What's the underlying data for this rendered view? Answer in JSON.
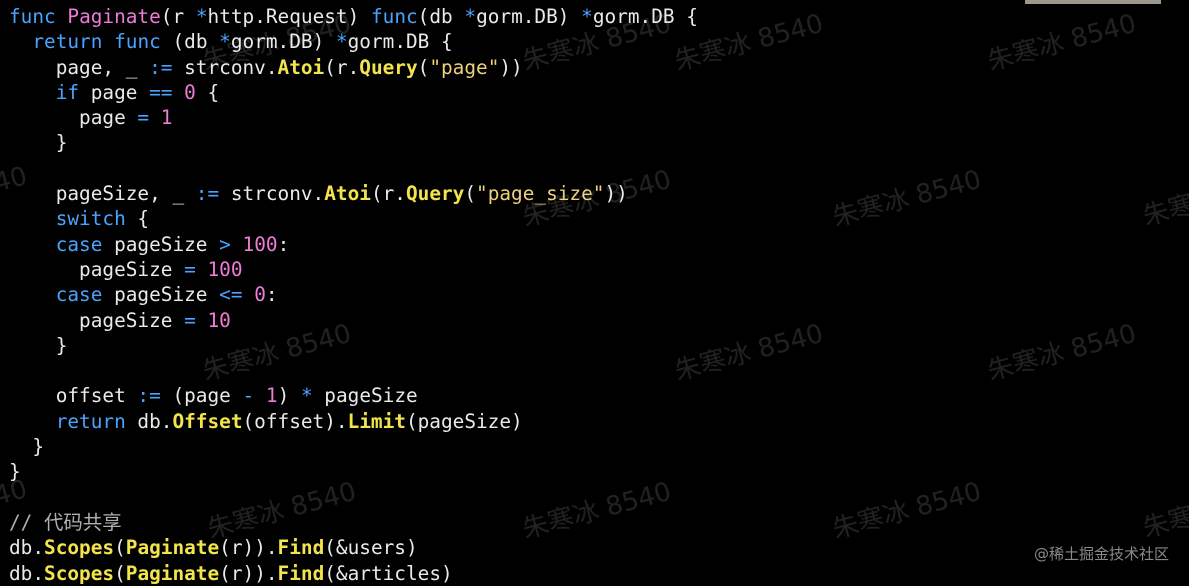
{
  "editor": {
    "lines": [
      [
        [
          "kw",
          "func"
        ],
        [
          "txt",
          " "
        ],
        [
          "fn",
          "Paginate"
        ],
        [
          "txt",
          "(r "
        ],
        [
          "op",
          "*"
        ],
        [
          "txt",
          "http.Request) "
        ],
        [
          "kw",
          "func"
        ],
        [
          "txt",
          "(db "
        ],
        [
          "op",
          "*"
        ],
        [
          "txt",
          "gorm.DB) "
        ],
        [
          "op",
          "*"
        ],
        [
          "txt",
          "gorm.DB {"
        ]
      ],
      [
        [
          "txt",
          "  "
        ],
        [
          "kw",
          "return"
        ],
        [
          "txt",
          " "
        ],
        [
          "kw",
          "func"
        ],
        [
          "txt",
          " (db "
        ],
        [
          "op",
          "*"
        ],
        [
          "txt",
          "gorm.DB) "
        ],
        [
          "op",
          "*"
        ],
        [
          "txt",
          "gorm.DB {"
        ]
      ],
      [
        [
          "txt",
          "    page, _ "
        ],
        [
          "op",
          ":="
        ],
        [
          "txt",
          " strconv."
        ],
        [
          "call",
          "Atoi"
        ],
        [
          "txt",
          "(r."
        ],
        [
          "call",
          "Query"
        ],
        [
          "txt",
          "("
        ],
        [
          "str",
          "\"page\""
        ],
        [
          "txt",
          "))"
        ]
      ],
      [
        [
          "txt",
          "    "
        ],
        [
          "kw",
          "if"
        ],
        [
          "txt",
          " page "
        ],
        [
          "op",
          "=="
        ],
        [
          "txt",
          " "
        ],
        [
          "num",
          "0"
        ],
        [
          "txt",
          " {"
        ]
      ],
      [
        [
          "txt",
          "      page "
        ],
        [
          "op",
          "="
        ],
        [
          "txt",
          " "
        ],
        [
          "num",
          "1"
        ]
      ],
      [
        [
          "txt",
          "    }"
        ]
      ],
      [],
      [
        [
          "txt",
          "    pageSize, _ "
        ],
        [
          "op",
          ":="
        ],
        [
          "txt",
          " strconv."
        ],
        [
          "call",
          "Atoi"
        ],
        [
          "txt",
          "(r."
        ],
        [
          "call",
          "Query"
        ],
        [
          "txt",
          "("
        ],
        [
          "str",
          "\"page_size\""
        ],
        [
          "txt",
          "))"
        ]
      ],
      [
        [
          "txt",
          "    "
        ],
        [
          "kw",
          "switch"
        ],
        [
          "txt",
          " {"
        ]
      ],
      [
        [
          "txt",
          "    "
        ],
        [
          "kw",
          "case"
        ],
        [
          "txt",
          " pageSize "
        ],
        [
          "op",
          ">"
        ],
        [
          "txt",
          " "
        ],
        [
          "num",
          "100"
        ],
        [
          "txt",
          ":"
        ]
      ],
      [
        [
          "txt",
          "      pageSize "
        ],
        [
          "op",
          "="
        ],
        [
          "txt",
          " "
        ],
        [
          "num",
          "100"
        ]
      ],
      [
        [
          "txt",
          "    "
        ],
        [
          "kw",
          "case"
        ],
        [
          "txt",
          " pageSize "
        ],
        [
          "op",
          "<="
        ],
        [
          "txt",
          " "
        ],
        [
          "num",
          "0"
        ],
        [
          "txt",
          ":"
        ]
      ],
      [
        [
          "txt",
          "      pageSize "
        ],
        [
          "op",
          "="
        ],
        [
          "txt",
          " "
        ],
        [
          "num",
          "10"
        ]
      ],
      [
        [
          "txt",
          "    }"
        ]
      ],
      [],
      [
        [
          "txt",
          "    offset "
        ],
        [
          "op",
          ":="
        ],
        [
          "txt",
          " (page "
        ],
        [
          "op",
          "-"
        ],
        [
          "txt",
          " "
        ],
        [
          "num",
          "1"
        ],
        [
          "txt",
          ") "
        ],
        [
          "op",
          "*"
        ],
        [
          "txt",
          " pageSize"
        ]
      ],
      [
        [
          "txt",
          "    "
        ],
        [
          "kw",
          "return"
        ],
        [
          "txt",
          " db."
        ],
        [
          "call",
          "Offset"
        ],
        [
          "txt",
          "(offset)."
        ],
        [
          "call",
          "Limit"
        ],
        [
          "txt",
          "(pageSize)"
        ]
      ],
      [
        [
          "txt",
          "  }"
        ]
      ],
      [
        [
          "txt",
          "}"
        ]
      ],
      [],
      [
        [
          "cm",
          "// 代码共享"
        ]
      ],
      [
        [
          "txt",
          "db."
        ],
        [
          "call",
          "Scopes"
        ],
        [
          "txt",
          "("
        ],
        [
          "call",
          "Paginate"
        ],
        [
          "txt",
          "(r))."
        ],
        [
          "call",
          "Find"
        ],
        [
          "txt",
          "(&users)"
        ]
      ],
      [
        [
          "txt",
          "db."
        ],
        [
          "call",
          "Scopes"
        ],
        [
          "txt",
          "("
        ],
        [
          "call",
          "Paginate"
        ],
        [
          "txt",
          "(r))."
        ],
        [
          "call",
          "Find"
        ],
        [
          "txt",
          "(&articles)"
        ]
      ]
    ]
  },
  "watermark": {
    "text": "朱寒冰 8540",
    "partial_text": "40",
    "partial_text_alt": "朱寒"
  },
  "footer": {
    "credit": "@稀土掘金技术社区"
  },
  "colors": {
    "background": "#000000",
    "keyword": "#4aa3ff",
    "function_name": "#ee7bd8",
    "method_call": "#f2e44c",
    "string": "#ecd27a",
    "number": "#ee7bd8",
    "operator": "#4aa3ff",
    "text": "#eaeaea",
    "comment": "#b0b0b0"
  }
}
